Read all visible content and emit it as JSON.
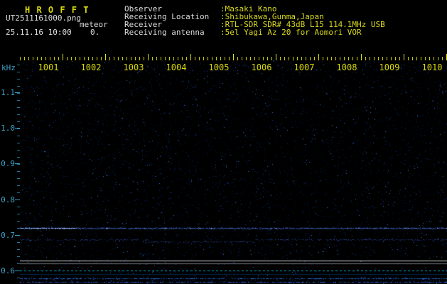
{
  "header": {
    "app_title": "H R O F F T",
    "filename": "UT2511161000.png",
    "mode": "meteor",
    "datetime": "25.11.16 10:00",
    "counter": "0.",
    "fields": [
      {
        "label": "Observer",
        "value": ":Masaki Kano"
      },
      {
        "label": "Receiving Location",
        "value": ":Shibukawa,Gunma,Japan"
      },
      {
        "label": "Receiver",
        "value": ":RTL-SDR SDR# 43dB L15 114.1MHz USB"
      },
      {
        "label": "Receiving antenna",
        "value": ":5el Yagi Az 20 for Aomori VOR"
      }
    ]
  },
  "chart_data": {
    "type": "heatmap",
    "title": "",
    "xlabel": "",
    "ylabel": "kHz",
    "y_ticks": [
      "1.1",
      "1.0",
      "0.9",
      "0.8",
      "0.7",
      "0.6"
    ],
    "y_tick_values": [
      1.1,
      1.0,
      0.9,
      0.8,
      0.7,
      0.6
    ],
    "ylim": [
      0.56,
      1.19
    ],
    "x_ticks": [
      "1001",
      "1002",
      "1003",
      "1004",
      "1005",
      "1006",
      "1007",
      "1008",
      "1009",
      "1010"
    ],
    "grid": false,
    "features": {
      "signal_lines_khz": [
        0.72,
        0.688
      ],
      "white_reference_lines_khz": [
        0.628,
        0.62
      ],
      "dashed_baseline_khz": 0.6,
      "noise_floor_line_khz": 0.59,
      "bottom_band_khz": [
        0.565,
        0.585
      ]
    }
  },
  "colors": {
    "background": "#000000",
    "title_yellow": "#d8d808",
    "text_white": "#dedede",
    "value_yellow": "#d8d820",
    "axis_cyan": "#3fa0c8",
    "tick_yellow": "#c8c808",
    "noise_blue": "#0040a0",
    "signal_blue": "#5080ff",
    "white_line": "#d2d2d2",
    "dashed_cyan": "#00b4d2"
  }
}
